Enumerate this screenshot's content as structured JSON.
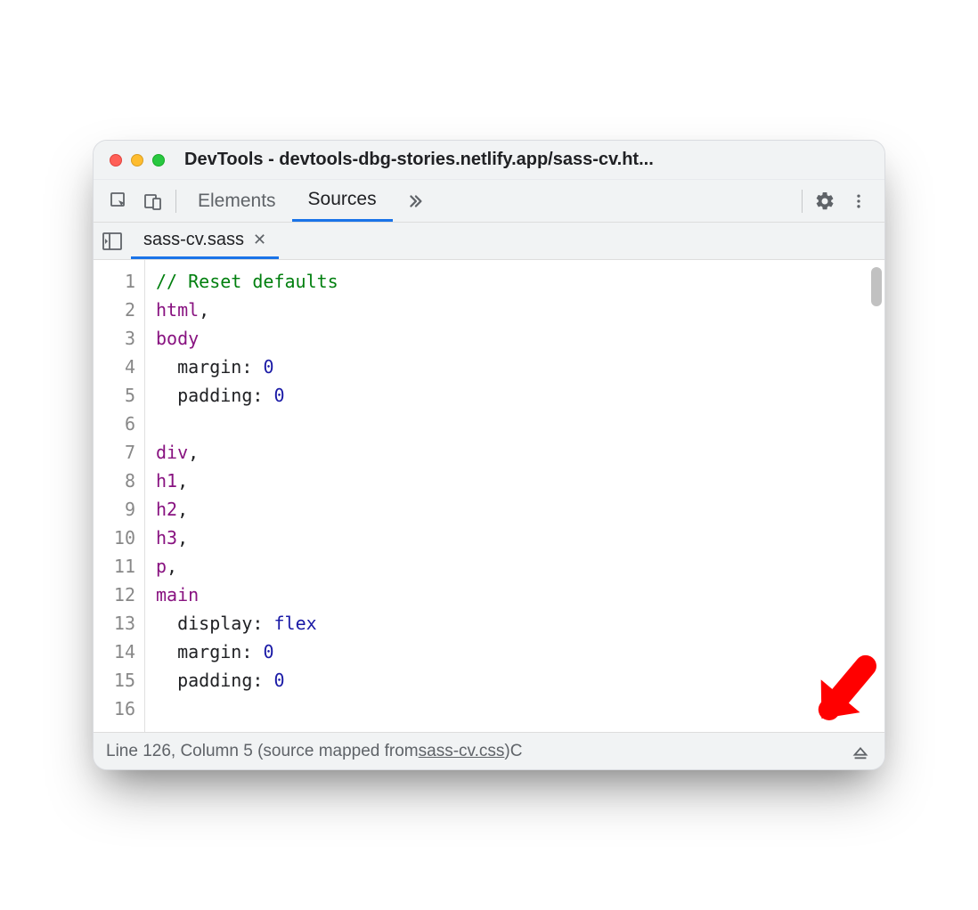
{
  "window": {
    "title": "DevTools - devtools-dbg-stories.netlify.app/sass-cv.ht..."
  },
  "toolbar": {
    "tabs": [
      "Elements",
      "Sources"
    ],
    "activeTab": "Sources"
  },
  "fileTabs": {
    "active": "sass-cv.sass"
  },
  "code": {
    "lines": [
      {
        "n": 1,
        "tokens": [
          {
            "t": "comment",
            "v": "// Reset defaults"
          }
        ]
      },
      {
        "n": 2,
        "tokens": [
          {
            "t": "selector",
            "v": "html"
          },
          {
            "t": "plain",
            "v": ","
          }
        ]
      },
      {
        "n": 3,
        "tokens": [
          {
            "t": "selector",
            "v": "body"
          }
        ]
      },
      {
        "n": 4,
        "tokens": [
          {
            "t": "plain",
            "v": "  "
          },
          {
            "t": "property",
            "v": "margin"
          },
          {
            "t": "plain",
            "v": ": "
          },
          {
            "t": "value",
            "v": "0"
          }
        ]
      },
      {
        "n": 5,
        "tokens": [
          {
            "t": "plain",
            "v": "  "
          },
          {
            "t": "property",
            "v": "padding"
          },
          {
            "t": "plain",
            "v": ": "
          },
          {
            "t": "value",
            "v": "0"
          }
        ]
      },
      {
        "n": 6,
        "tokens": []
      },
      {
        "n": 7,
        "tokens": [
          {
            "t": "selector",
            "v": "div"
          },
          {
            "t": "plain",
            "v": ","
          }
        ]
      },
      {
        "n": 8,
        "tokens": [
          {
            "t": "selector",
            "v": "h1"
          },
          {
            "t": "plain",
            "v": ","
          }
        ]
      },
      {
        "n": 9,
        "tokens": [
          {
            "t": "selector",
            "v": "h2"
          },
          {
            "t": "plain",
            "v": ","
          }
        ]
      },
      {
        "n": 10,
        "tokens": [
          {
            "t": "selector",
            "v": "h3"
          },
          {
            "t": "plain",
            "v": ","
          }
        ]
      },
      {
        "n": 11,
        "tokens": [
          {
            "t": "selector",
            "v": "p"
          },
          {
            "t": "plain",
            "v": ","
          }
        ]
      },
      {
        "n": 12,
        "tokens": [
          {
            "t": "selector",
            "v": "main"
          }
        ]
      },
      {
        "n": 13,
        "tokens": [
          {
            "t": "plain",
            "v": "  "
          },
          {
            "t": "property",
            "v": "display"
          },
          {
            "t": "plain",
            "v": ": "
          },
          {
            "t": "value",
            "v": "flex"
          }
        ]
      },
      {
        "n": 14,
        "tokens": [
          {
            "t": "plain",
            "v": "  "
          },
          {
            "t": "property",
            "v": "margin"
          },
          {
            "t": "plain",
            "v": ": "
          },
          {
            "t": "value",
            "v": "0"
          }
        ]
      },
      {
        "n": 15,
        "tokens": [
          {
            "t": "plain",
            "v": "  "
          },
          {
            "t": "property",
            "v": "padding"
          },
          {
            "t": "plain",
            "v": ": "
          },
          {
            "t": "value",
            "v": "0"
          }
        ]
      },
      {
        "n": 16,
        "tokens": []
      }
    ]
  },
  "statusbar": {
    "position": "Line 126, Column 5",
    "mapped_prefix": "(source mapped from ",
    "mapped_link": "sass-cv.css",
    "mapped_suffix": ")",
    "trailing": " C"
  }
}
